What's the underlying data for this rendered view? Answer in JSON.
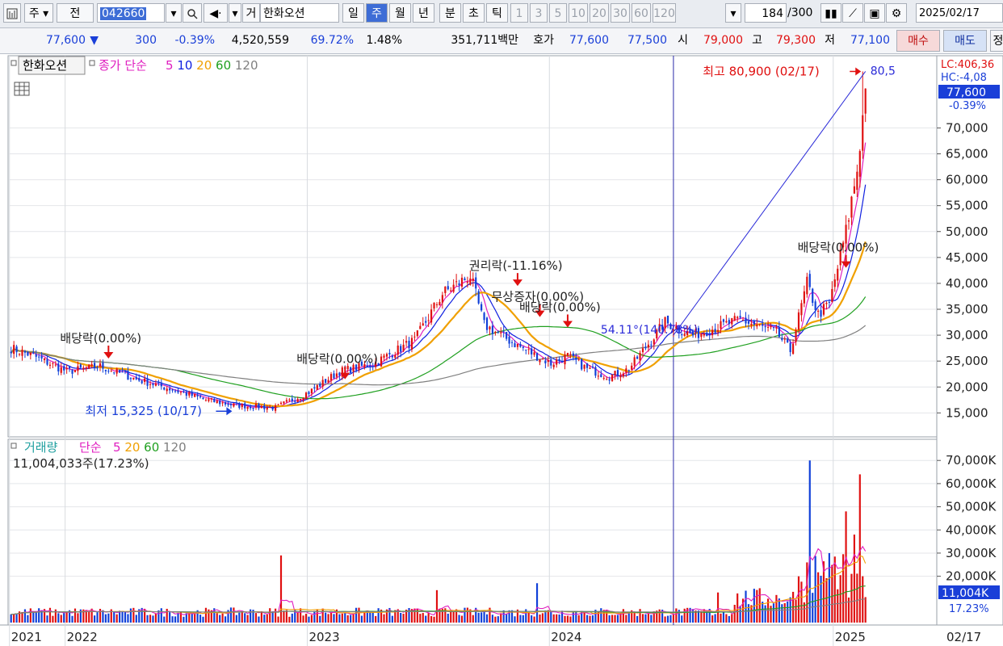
{
  "toolbar": {
    "icon_chart": "chart-icon",
    "market": "주",
    "prev": "전",
    "code": "042660",
    "name_prefix": "거",
    "stock_name": "한화오션",
    "periods": [
      "일",
      "주",
      "월",
      "년",
      "분",
      "초",
      "틱"
    ],
    "selected_period": "주",
    "intervals": [
      "1",
      "3",
      "5",
      "10",
      "20",
      "30",
      "60",
      "120"
    ],
    "count": "184",
    "count_total": "/300",
    "date": "2025/02/17"
  },
  "quote": {
    "price": "77,600",
    "arrow": "▼",
    "change": "300",
    "change_pct": "-0.39%",
    "volume": "4,520,559",
    "volume_ratio": "69.72%",
    "turnover": "1.48%",
    "amount": "351,711백만",
    "bid_label": "호가",
    "ask": "77,600",
    "bid": "77,500",
    "open_label": "시",
    "open": "79,000",
    "high_label": "고",
    "high": "79,300",
    "low_label": "저",
    "low": "77,100",
    "buy_label": "매수",
    "sell_label": "매도",
    "edge_label": "정"
  },
  "price_panel": {
    "stock_name": "한화오션",
    "ma_label": "종가 단순",
    "ma_periods": [
      "5",
      "10",
      "20",
      "60",
      "120"
    ],
    "ma_colors": [
      "#e020c0",
      "#1020e0",
      "#f0a000",
      "#20a020",
      "#808080"
    ],
    "lc_text": "LC:406,36",
    "hc_text": "HC:-4,08",
    "current_price": "77,600",
    "current_pct": "-0.39%",
    "trendline_label": "80,5",
    "high_annotation": "최고 80,900 (02/17)",
    "low_annotation": "최저 15,325 (10/17)",
    "angle_annotation": "54.11°(140.78%)",
    "event_labels": [
      "배당락(0.00%)",
      "배당락(0.00%)",
      "권리락(-11.16%)",
      "무상증자(0.00%)",
      "배당락(0.00%)",
      "배당락(0.00%)"
    ]
  },
  "volume_panel": {
    "title": "거래량",
    "ma_label": "단순",
    "ma_periods": [
      "5",
      "20",
      "60",
      "120"
    ],
    "ma_colors": [
      "#e020c0",
      "#f0a000",
      "#20a020",
      "#808080"
    ],
    "current_volume": "11,004,033주(17.23%)",
    "current_tag": "11,004K",
    "current_pct": "17.23%"
  },
  "chart_data": {
    "type": "candlestick",
    "series_name": "한화오션",
    "period": "weekly",
    "price_axis": {
      "ticks": [
        15000,
        20000,
        25000,
        30000,
        35000,
        40000,
        45000,
        50000,
        55000,
        60000,
        65000,
        70000
      ],
      "tick_labels": [
        "15,000",
        "20,000",
        "25,000",
        "30,000",
        "35,000",
        "40,000",
        "45,000",
        "50,000",
        "55,000",
        "60,000",
        "65,000",
        "70,000"
      ],
      "range": [
        11000,
        83000
      ]
    },
    "volume_axis": {
      "ticks": [
        20000,
        30000,
        40000,
        50000,
        60000,
        70000
      ],
      "tick_labels": [
        "20,000K",
        "30,000K",
        "40,000K",
        "50,000K",
        "60,000K",
        "70,000K"
      ],
      "unit": "K",
      "range": [
        0,
        76000
      ]
    },
    "x_axis": {
      "labels": [
        "2021",
        "2022",
        "2023",
        "2024",
        "2025",
        "02/17"
      ],
      "label_weeks": [
        0,
        20,
        107,
        194,
        296,
        324
      ]
    },
    "weeks": 308,
    "price_path": [
      [
        0,
        27500
      ],
      [
        8,
        26000
      ],
      [
        20,
        23000
      ],
      [
        32,
        24000
      ],
      [
        45,
        21500
      ],
      [
        58,
        19500
      ],
      [
        70,
        17500
      ],
      [
        80,
        16500
      ],
      [
        95,
        16000
      ],
      [
        107,
        19000
      ],
      [
        118,
        23000
      ],
      [
        130,
        24500
      ],
      [
        145,
        29000
      ],
      [
        155,
        38000
      ],
      [
        165,
        41500
      ],
      [
        170,
        32000
      ],
      [
        182,
        28000
      ],
      [
        194,
        24500
      ],
      [
        200,
        26000
      ],
      [
        207,
        23500
      ],
      [
        215,
        22000
      ],
      [
        222,
        23500
      ],
      [
        235,
        32500
      ],
      [
        245,
        30000
      ],
      [
        262,
        33000
      ],
      [
        275,
        30500
      ],
      [
        280,
        27000
      ],
      [
        286,
        40000
      ],
      [
        290,
        34000
      ],
      [
        294,
        36000
      ],
      [
        300,
        50000
      ],
      [
        304,
        62000
      ],
      [
        306,
        72000
      ],
      [
        307,
        77600
      ]
    ],
    "high": {
      "value": 80900,
      "label": "최고 80,900 (02/17)"
    },
    "low": {
      "value": 15325,
      "label": "최저 15,325 (10/17)"
    },
    "events": [
      {
        "week": 35,
        "label": "배당락(0.00%)",
        "price": 25500
      },
      {
        "week": 120,
        "label": "배당락(0.00%)",
        "price": 21500
      },
      {
        "week": 182,
        "label": "권리락(-11.16%)",
        "price": 39500
      },
      {
        "week": 190,
        "label": "무상증자(0.00%)",
        "price": 33500
      },
      {
        "week": 200,
        "label": "배당락(0.00%)",
        "price": 31500
      },
      {
        "week": 300,
        "label": "배당락(0.00%)",
        "price": 43000
      }
    ],
    "volume_spikes": [
      {
        "week": 97,
        "value": 29000
      },
      {
        "week": 153,
        "value": 14000
      },
      {
        "week": 189,
        "value": 17000
      },
      {
        "week": 254,
        "value": 13000
      },
      {
        "week": 287,
        "value": 70000
      },
      {
        "week": 300,
        "value": 48000
      },
      {
        "week": 303,
        "value": 38000
      },
      {
        "week": 305,
        "value": 64000
      },
      {
        "week": 307,
        "value": 11004
      }
    ],
    "last_volume": 11004
  }
}
